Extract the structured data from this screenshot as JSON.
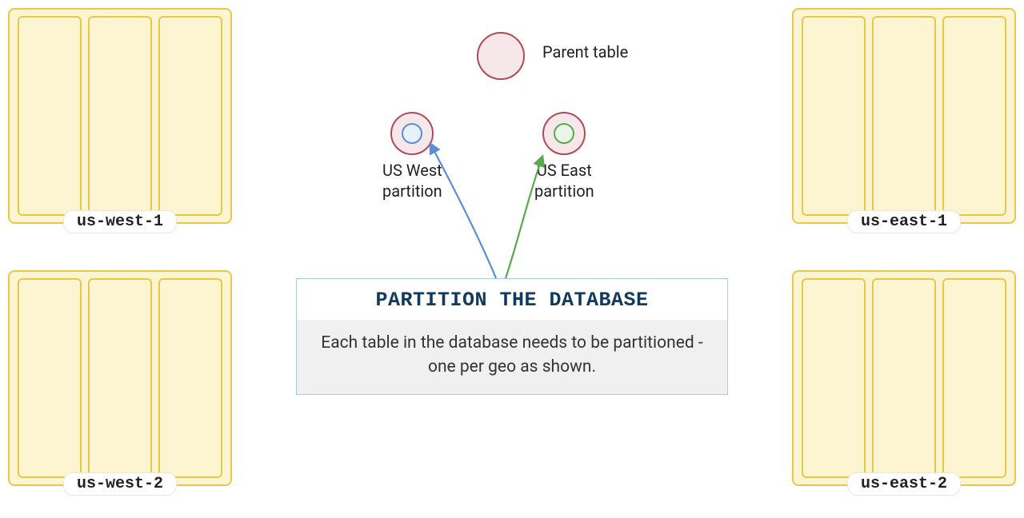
{
  "regions": {
    "tl": "us-west-1",
    "tr": "us-east-1",
    "bl": "us-west-2",
    "br": "us-east-2"
  },
  "legend": {
    "parent": "Parent table",
    "west": "US West\npartition",
    "east": "US East\npartition"
  },
  "infobox": {
    "title": "PARTITION THE DATABASE",
    "body": "Each table in the database needs to be partitioned - one per geo as shown."
  },
  "colors": {
    "blue": "#5b8ed6",
    "green": "#5aa84f",
    "maroon": "#b04a5a"
  }
}
